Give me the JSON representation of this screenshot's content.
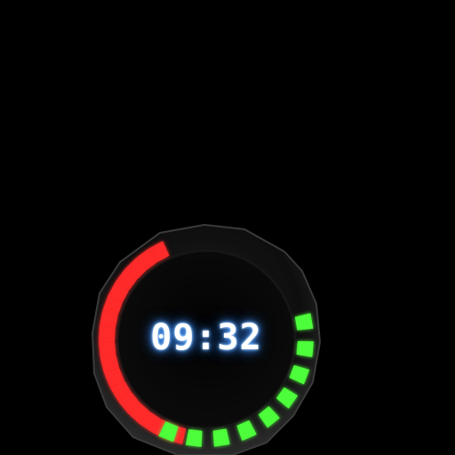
{
  "timer": {
    "display": "09:32"
  },
  "dial": {
    "progress_segments_total": 26,
    "red_segments": 17,
    "green_segments": 9,
    "colors": {
      "red_segment": "#ff2a2a",
      "red_glow": "#ff0000",
      "green_segment": "#4dff3a",
      "green_glow": "#22ff00",
      "bezel": "#141414",
      "bezel_edge": "#3a3a3a",
      "face": "#050505",
      "digit_glow": "#3a8dff"
    }
  }
}
